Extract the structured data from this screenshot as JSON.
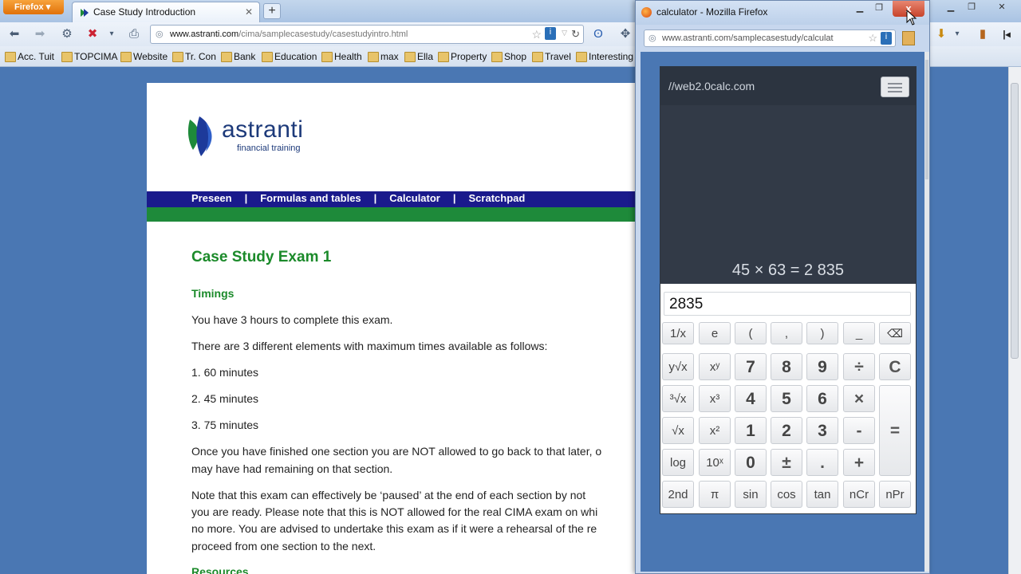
{
  "browser": {
    "menu_label": "Firefox",
    "tab_title": "Case Study Introduction",
    "newtab_label": "+",
    "url_domain": "www.astranti.com",
    "url_path": "/cima/samplecasestudy/casestudyintro.html",
    "bookmarks": [
      "Acc. Tuit",
      "TOPCIMA",
      "Website",
      "Tr. Con",
      "Bank",
      "Education",
      "Health",
      "max",
      "Ella",
      "Property",
      "Shop",
      "Travel",
      "Interesting"
    ]
  },
  "page": {
    "logo_word": "astranti",
    "logo_sub": "financial training",
    "nav": [
      "Preseen",
      "Formulas and tables",
      "Calculator",
      "Scratchpad"
    ],
    "nav_sep": "|",
    "heading": "Case Study Exam 1",
    "timings_heading": "Timings",
    "p1": "You have 3 hours to complete this exam.",
    "p2": "There are 3 different elements with maximum times available as follows:",
    "items": [
      "1. 60 minutes",
      "2. 45 minutes",
      "3. 75 minutes"
    ],
    "p3a": "Once you have finished one section you are NOT allowed to go back to that later, o",
    "p3b": "may have had remaining on that section.",
    "p4a": "Note that this exam can effectively be ‘paused’ at the end of each section by not",
    "p4b": "you are ready. Please note that this is NOT allowed for the real CIMA exam on whi",
    "p4c": "no more. You are advised to undertake this exam as if it were a rehearsal of the re",
    "p4d": "proceed from one section to the next.",
    "resources_heading": "Resources"
  },
  "popup": {
    "title": "calculator - Mozilla Firefox",
    "close_label": "x",
    "url": "www.astranti.com/samplecasestudy/calculat"
  },
  "calculator": {
    "brand": "//web2.0calc.com",
    "expression": "45 × 63 = 2 835",
    "input_value": "2835",
    "keys": {
      "r1": [
        "1/x",
        "e",
        "(",
        ",",
        ")",
        "_",
        "⌫"
      ],
      "r2": [
        "y√x",
        "xʸ",
        "7",
        "8",
        "9",
        "÷",
        "C"
      ],
      "r3": [
        "³√x",
        "x³",
        "4",
        "5",
        "6",
        "×"
      ],
      "r4": [
        "√x",
        "x²",
        "1",
        "2",
        "3",
        "-",
        "="
      ],
      "r5": [
        "log",
        "10ˣ",
        "0",
        "±",
        ".",
        "+"
      ],
      "r6": [
        "2nd",
        "π",
        "sin",
        "cos",
        "tan",
        "nCr",
        "nPr"
      ]
    }
  }
}
